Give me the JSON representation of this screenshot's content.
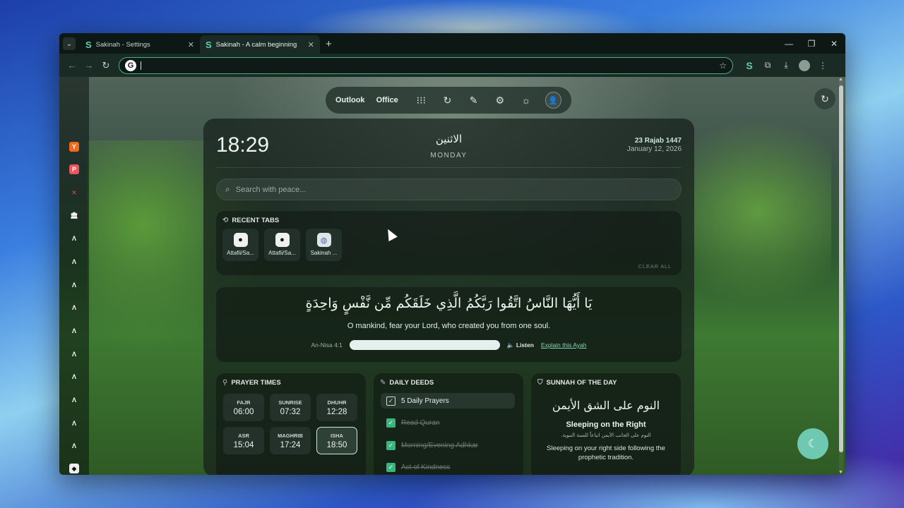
{
  "browser": {
    "tabs": [
      {
        "title": "Sakinah - Settings",
        "active": false
      },
      {
        "title": "Sakinah - A calm beginning",
        "active": true
      }
    ],
    "url": "",
    "accent": "#46b08c"
  },
  "sidebar": {
    "icons": [
      "y-icon",
      "p-icon",
      "x-icon",
      "museum-icon",
      "app-icon",
      "app-icon",
      "app-icon",
      "app-icon",
      "app-icon",
      "app-icon",
      "app-icon",
      "app-icon",
      "app-icon",
      "app-icon",
      "app-icon"
    ]
  },
  "top_bar": {
    "links": [
      "Outlook",
      "Office"
    ],
    "icons": [
      "apps-grid-icon",
      "refresh-icon",
      "pen-icon",
      "gear-icon",
      "sun-icon",
      "user-icon"
    ]
  },
  "header": {
    "time": "18:29",
    "day_ar": "الاثنين",
    "day_en": "MONDAY",
    "hijri_date": "23 Rajab 1447",
    "gregorian_date": "January 12, 2026"
  },
  "search": {
    "placeholder": "Search with peace..."
  },
  "recent_tabs": {
    "title": "RECENT TABS",
    "items": [
      {
        "label": "Attafii/Sa...",
        "icon": "github-icon"
      },
      {
        "label": "Attafii/Sa...",
        "icon": "github-icon"
      },
      {
        "label": "Sakinah ...",
        "icon": "globe-icon"
      }
    ],
    "clear_label": "CLEAR ALL"
  },
  "ayah": {
    "arabic": "يَا أَيُّهَا النَّاسُ اتَّقُوا رَبَّكُمُ الَّذِي خَلَقَكُم مِّن نَّفْسٍ وَاحِدَةٍ",
    "translation": "O mankind, fear your Lord, who created you from one soul.",
    "reference": "An-Nisa 4:1",
    "listen_label": "Listen",
    "explain_label": "Explain this Ayah"
  },
  "prayer_times": {
    "title": "PRAYER TIMES",
    "items": [
      {
        "name": "FAJR",
        "time": "06:00",
        "current": false
      },
      {
        "name": "SUNRISE",
        "time": "07:32",
        "current": false
      },
      {
        "name": "DHUHR",
        "time": "12:28",
        "current": false
      },
      {
        "name": "ASR",
        "time": "15:04",
        "current": false
      },
      {
        "name": "MAGHRIB",
        "time": "17:24",
        "current": false
      },
      {
        "name": "ISHA",
        "time": "18:50",
        "current": true
      }
    ]
  },
  "daily_deeds": {
    "title": "DAILY DEEDS",
    "items": [
      {
        "label": "5 Daily Prayers",
        "done": false
      },
      {
        "label": "Read Quran",
        "done": true
      },
      {
        "label": "Morning/Evening Adhkar",
        "done": true
      },
      {
        "label": "Act of Kindness",
        "done": true
      }
    ]
  },
  "sunnah": {
    "title": "SUNNAH OF THE DAY",
    "arabic": "النوم على الشق الأيمن",
    "english_title": "Sleeping on the Right",
    "arabic_small": "النوم على الجانب الأيمن اتباعاً للسنة النبوية.",
    "description": "Sleeping on your right side following the prophetic tradition."
  }
}
